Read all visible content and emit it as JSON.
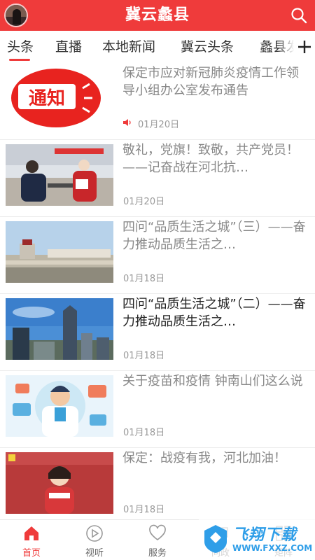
{
  "header": {
    "title": "冀云蠡县"
  },
  "tabs": [
    {
      "label": "头条"
    },
    {
      "label": "直播"
    },
    {
      "label": "本地新闻"
    },
    {
      "label": "冀云头条"
    },
    {
      "label": "蠡县发"
    }
  ],
  "articles": [
    {
      "title": "保定市应对新冠肺炎疫情工作领导小组办公室发布通告",
      "date": "01月20日",
      "thumb_text": "通知",
      "audio": true
    },
    {
      "title": "敬礼，党旗！致敬，共产党员！——记奋战在河北抗…",
      "date": "01月20日"
    },
    {
      "title": "四问“品质生活之城”（三）——奋力推动品质生活之…",
      "date": "01月18日"
    },
    {
      "title": "四问“品质生活之城”（二）——奋力推动品质生活之…",
      "date": "01月18日"
    },
    {
      "title": "关于疫苗和疫情 钟南山们这么说",
      "date": "01月18日"
    },
    {
      "title": "保定：战疫有我，河北加油！",
      "date": "01月18日"
    }
  ],
  "bottom_nav": [
    {
      "label": "首页",
      "icon": "home-icon"
    },
    {
      "label": "视听",
      "icon": "play-icon"
    },
    {
      "label": "服务",
      "icon": "heart-icon"
    },
    {
      "label": "问政",
      "icon": "chat-icon"
    },
    {
      "label": "矩阵",
      "icon": "grid-icon"
    }
  ],
  "watermark": {
    "text": "飞翔下载",
    "url": "WWW.FXXZ.COM"
  },
  "colors": {
    "brand": "#ef3b3b",
    "text_read": "#222222",
    "text_unread": "#888888",
    "date": "#999999"
  }
}
